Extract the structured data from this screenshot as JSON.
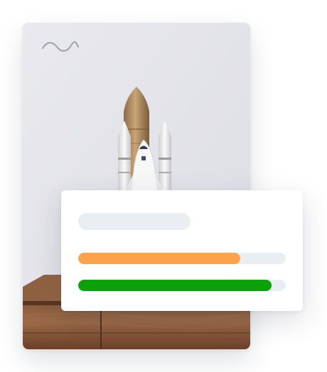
{
  "hero": {
    "decoration_icon": "squiggle-icon",
    "image": "rocket-model-on-wooden-table"
  },
  "stats_card": {
    "bars": [
      {
        "progress": 0.78,
        "color": "#fba24b",
        "track_color": "#e9eef3"
      },
      {
        "progress": 0.93,
        "color": "#0aa10a",
        "track_color": "#e9eef3"
      }
    ]
  }
}
